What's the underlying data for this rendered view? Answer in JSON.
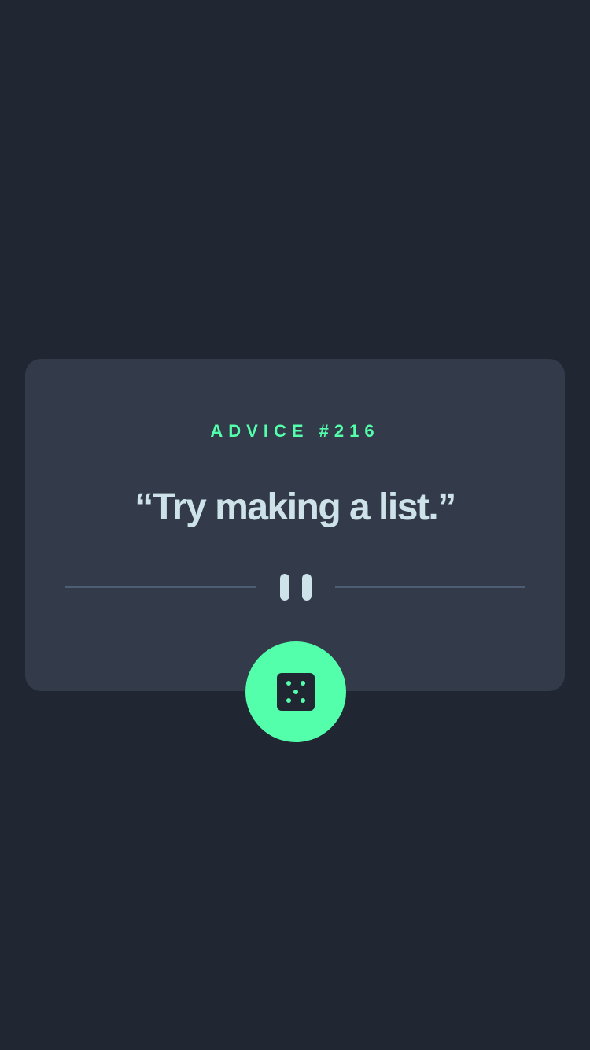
{
  "advice": {
    "label": "ADVICE #216",
    "quote": "“Try making a list.”"
  },
  "controls": {
    "generate_button": {
      "icon": "dice-icon"
    },
    "divider": {
      "icon": "pause-icon"
    }
  },
  "colors": {
    "background": "#202632",
    "card": "#333a4a",
    "accent": "#53ffab",
    "text": "#cee3e9",
    "divider": "#4e5d73"
  }
}
